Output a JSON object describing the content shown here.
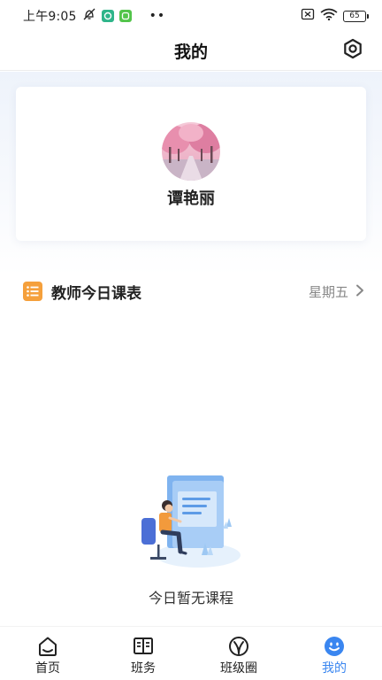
{
  "status_bar": {
    "time": "上午9:05",
    "dots": "••",
    "battery": "65"
  },
  "header": {
    "title": "我的"
  },
  "profile": {
    "name": "谭艳丽"
  },
  "schedule": {
    "title": "教师今日课表",
    "day": "星期五"
  },
  "empty_state": {
    "text": "今日暂无课程"
  },
  "tab_bar": {
    "items": [
      {
        "label": "首页",
        "icon": "home-icon"
      },
      {
        "label": "班务",
        "icon": "book-icon"
      },
      {
        "label": "班级圈",
        "icon": "circle-icon"
      },
      {
        "label": "我的",
        "icon": "smiley-icon"
      }
    ],
    "active": "我的"
  },
  "colors": {
    "accent": "#3a86f0",
    "schedule_icon": "#f5a03c",
    "text_primary": "#222222",
    "text_secondary": "#888888"
  }
}
